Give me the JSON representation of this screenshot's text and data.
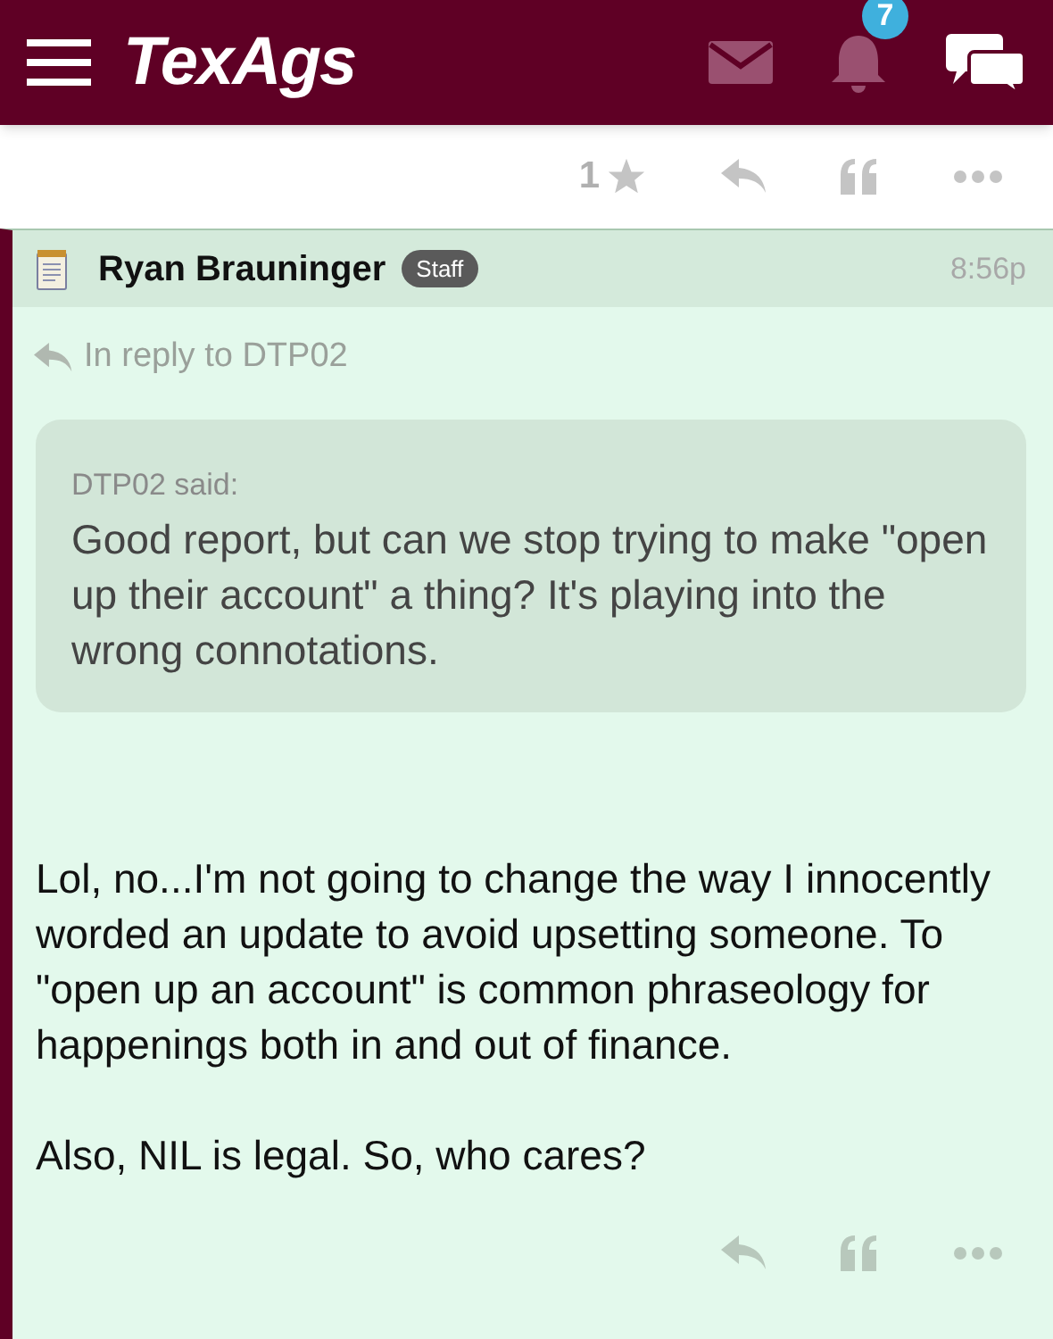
{
  "header": {
    "logo": "TexAgs",
    "notification_count": "7"
  },
  "toolbar": {
    "star_count": "1"
  },
  "post": {
    "author": "Ryan Brauninger",
    "badge": "Staff",
    "time": "8:56p",
    "reply_to": "In reply to DTP02",
    "quote": {
      "author": "DTP02 said:",
      "text": "Good report, but can we stop trying to make \"open up their account\" a thing? It's playing into the wrong connotations."
    },
    "paragraphs": [
      "Lol, no...I'm not going to change the way I innocently worded an update to avoid upsetting someone. To \"open up an account\" is common phraseology for happenings both in and out of finance.",
      "Also, NIL is legal. So, who cares?"
    ]
  }
}
